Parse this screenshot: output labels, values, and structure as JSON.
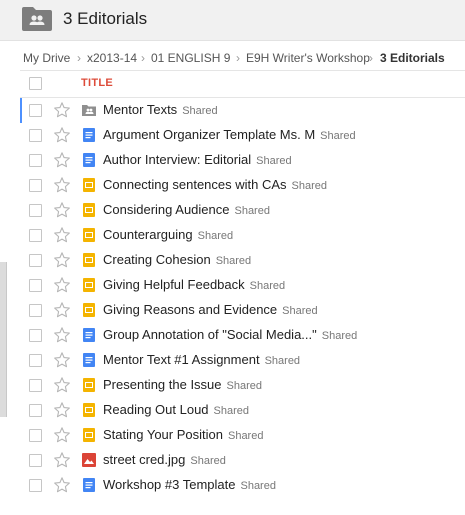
{
  "header": {
    "title": "3 Editorials",
    "folder_icon": "shared-folder-icon"
  },
  "breadcrumb": [
    "My Drive",
    "x2013-14",
    "01 ENGLISH 9",
    "E9H Writer's Workshop",
    "3 Editorials"
  ],
  "columns": {
    "title": "TITLE"
  },
  "colors": {
    "accent_red": "#dd4b39",
    "doc_blue": "#4285f4",
    "slides_yellow": "#f4b400",
    "image_red": "#db4437",
    "folder_gray": "#8f8f8f",
    "focus_blue": "#4d90fe"
  },
  "files": [
    {
      "name": "Mentor Texts",
      "status": "Shared",
      "type": "shared-folder"
    },
    {
      "name": "Argument Organizer Template Ms. M",
      "status": "Shared",
      "type": "doc"
    },
    {
      "name": "Author Interview: Editorial",
      "status": "Shared",
      "type": "doc"
    },
    {
      "name": "Connecting sentences with CAs",
      "status": "Shared",
      "type": "slides"
    },
    {
      "name": "Considering Audience",
      "status": "Shared",
      "type": "slides"
    },
    {
      "name": "Counterarguing",
      "status": "Shared",
      "type": "slides"
    },
    {
      "name": "Creating Cohesion",
      "status": "Shared",
      "type": "slides"
    },
    {
      "name": "Giving Helpful Feedback",
      "status": "Shared",
      "type": "slides"
    },
    {
      "name": "Giving Reasons and Evidence",
      "status": "Shared",
      "type": "slides"
    },
    {
      "name": "Group Annotation of \"Social Media...\"",
      "status": "Shared",
      "type": "doc"
    },
    {
      "name": "Mentor Text #1 Assignment",
      "status": "Shared",
      "type": "doc"
    },
    {
      "name": "Presenting the Issue",
      "status": "Shared",
      "type": "slides"
    },
    {
      "name": "Reading Out Loud",
      "status": "Shared",
      "type": "slides"
    },
    {
      "name": "Stating Your Position",
      "status": "Shared",
      "type": "slides"
    },
    {
      "name": "street cred.jpg",
      "status": "Shared",
      "type": "image"
    },
    {
      "name": "Workshop #3 Template",
      "status": "Shared",
      "type": "doc"
    }
  ]
}
